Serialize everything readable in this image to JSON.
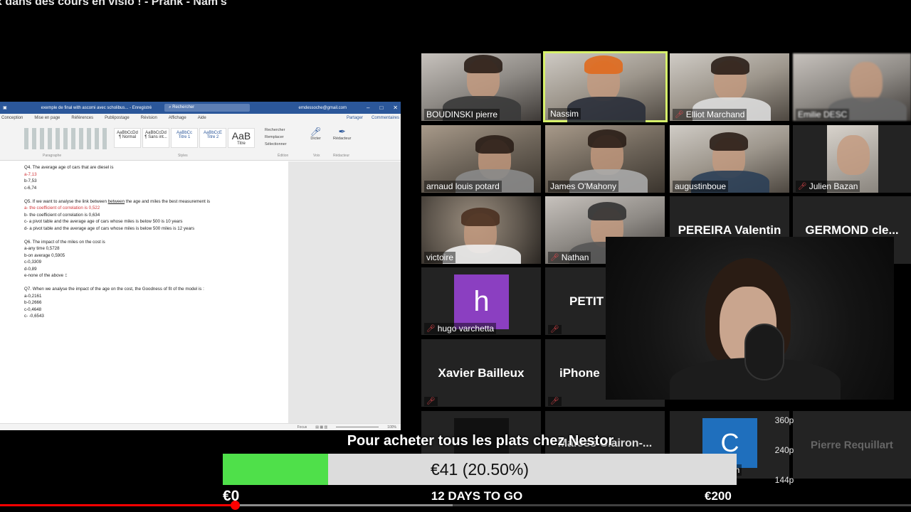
{
  "video": {
    "title": "x dans des cours en visio ! - Prank - Nam's"
  },
  "word": {
    "doc_title": "exemple de final with ascomi avec scholibus... - Enregistré",
    "search_placeholder": "Rechercher",
    "user_email": "emdessoche@gmail.com",
    "tabs": [
      "Conception",
      "Mise en page",
      "Références",
      "Publipostage",
      "Révision",
      "Affichage",
      "Aide"
    ],
    "share_label": "Partager",
    "comments_label": "Commentaires",
    "styles": [
      {
        "preview": "AaBbCcDd",
        "name": "¶ Normal"
      },
      {
        "preview": "AaBbCcDd",
        "name": "¶ Sans int..."
      },
      {
        "preview": "AaBbCc",
        "name": "Titre 1"
      },
      {
        "preview": "AaBbCcE",
        "name": "Titre 2"
      },
      {
        "preview": "AaB",
        "name": "Titre"
      }
    ],
    "ribbon_right": [
      "Rechercher",
      "Remplacer",
      "Sélectionner"
    ],
    "ribbon_groups": [
      "Paragraphe",
      "Styles",
      "Édition",
      "Voix",
      "Rédacteur"
    ],
    "dictate_label": "Dicter",
    "editor_label": "Rédacteur",
    "questions": [
      {
        "q": "Q4. The average age of cars that are diesel is",
        "answers": [
          {
            "text": "a-7,13",
            "red": true
          },
          {
            "text": "b-7,53",
            "red": false
          },
          {
            "text": "c-6,74",
            "red": false
          }
        ]
      },
      {
        "q_prefix": "Q5. If we want to analyse the link between ",
        "q_ul": "between",
        "q_suffix": " the age and miles the best measurement is",
        "answers": [
          {
            "text": "a- the coefficient of correlation is 0,522",
            "red": true
          },
          {
            "text": "b- the coefficient of correlation is 0,634",
            "red": false
          },
          {
            "text": "c- a pivot table and the average age of cars whose miles is below 500 is 10 years",
            "red": false
          },
          {
            "text": "d- a pivot table and the average age of cars whose miles is below 500 miles is 12 years",
            "red": false
          }
        ]
      },
      {
        "q": "Q6. The impact of the miles on the cost is",
        "answers": [
          {
            "text": "a-any time 0,5728",
            "red": false
          },
          {
            "text": "b-on average 0,5905",
            "red": false
          },
          {
            "text": "c-0,3309",
            "red": false
          },
          {
            "text": "d-0,89",
            "red": false
          },
          {
            "text": "e-none of the above",
            "red": false
          }
        ]
      },
      {
        "q": "Q7. When we analyse the impact of the age on the cost, the Goodness of fit of the model is :",
        "answers": [
          {
            "text": "a-0,2161",
            "red": false
          },
          {
            "text": "b-0,2666",
            "red": false
          },
          {
            "text": "c-0,4648",
            "red": false
          },
          {
            "text": "c- -0,6543",
            "red": false
          }
        ]
      }
    ],
    "status_labels": [
      "Focus",
      "100%"
    ]
  },
  "zoom": {
    "participants": [
      {
        "name": "BOUDINSKI pierre",
        "muted": false
      },
      {
        "name": "Nassim",
        "muted": false,
        "active": true
      },
      {
        "name": "Elliot Marchand",
        "muted": true
      },
      {
        "name": "Emilie DESC",
        "muted": false
      },
      {
        "name": "arnaud louis potard",
        "muted": false
      },
      {
        "name": "James O'Mahony",
        "muted": false
      },
      {
        "name": "augustinboue",
        "muted": false
      },
      {
        "name": "Julien Bazan",
        "muted": true
      },
      {
        "name": "victoire",
        "muted": false
      },
      {
        "name": "Nathan",
        "muted": true
      },
      {
        "name": "PEREIRA Valentin",
        "muted": false
      },
      {
        "name": "GERMOND  cle...",
        "muted": false
      },
      {
        "name": "hugo varchetta",
        "muted": true,
        "avatar": "h"
      },
      {
        "name": "PETIT",
        "muted": true
      },
      {
        "name": "Xavier Bailleux",
        "muted": true
      },
      {
        "name": "iPhone",
        "muted": true
      },
      {
        "name": "Maloss Clairon-...",
        "muted": false
      },
      {
        "name": "Pierre Requillart",
        "muted": false
      },
      {
        "name": "rin",
        "muted": false,
        "avatar": "C"
      }
    ]
  },
  "quality_menu": {
    "options": [
      "360p",
      "240p",
      "144p"
    ]
  },
  "donation": {
    "title": "Pour acheter tous les plats chez Nestor",
    "amount_text": "€41 (20.50%)",
    "progress_fraction": 0.205,
    "min_label": "€0",
    "max_label": "€200",
    "days_label": "12 DAYS TO GO",
    "bar_color": "#4fe04a"
  },
  "player": {
    "played_fraction": 0.258,
    "buffered_fraction": 0.497
  }
}
